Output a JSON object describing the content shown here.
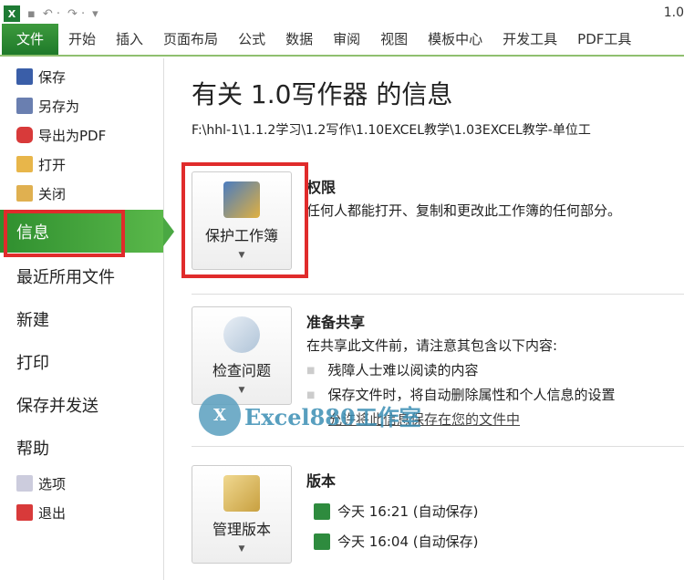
{
  "window": {
    "title": "1.0"
  },
  "ribbon": {
    "tabs": [
      "文件",
      "开始",
      "插入",
      "页面布局",
      "公式",
      "数据",
      "审阅",
      "视图",
      "模板中心",
      "开发工具",
      "PDF工具"
    ]
  },
  "sidebar": {
    "small_top": [
      "保存",
      "另存为",
      "导出为PDF",
      "打开",
      "关闭"
    ],
    "big": [
      "信息",
      "最近所用文件",
      "新建",
      "打印",
      "保存并发送",
      "帮助"
    ],
    "small_bottom": [
      "选项",
      "退出"
    ]
  },
  "main": {
    "title": "有关 1.0写作器 的信息",
    "path": "F:\\hhl-1\\1.1.2学习\\1.2写作\\1.10EXCEL教学\\1.03EXCEL教学-单位工",
    "permissions": {
      "button": "保护工作簿",
      "heading": "权限",
      "desc": "任何人都能打开、复制和更改此工作簿的任何部分。"
    },
    "prepare": {
      "button": "检查问题",
      "heading": "准备共享",
      "desc": "在共享此文件前，请注意其包含以下内容:",
      "bullets": [
        "残障人士难以阅读的内容",
        "保存文件时，将自动删除属性和个人信息的设置"
      ],
      "link": "允许将此信息保存在您的文件中"
    },
    "versions": {
      "button": "管理版本",
      "heading": "版本",
      "items": [
        "今天 16:21 (自动保存)",
        "今天 16:04 (自动保存)"
      ]
    }
  },
  "watermark": {
    "text": "Excel880工作室",
    "logo": "X"
  }
}
